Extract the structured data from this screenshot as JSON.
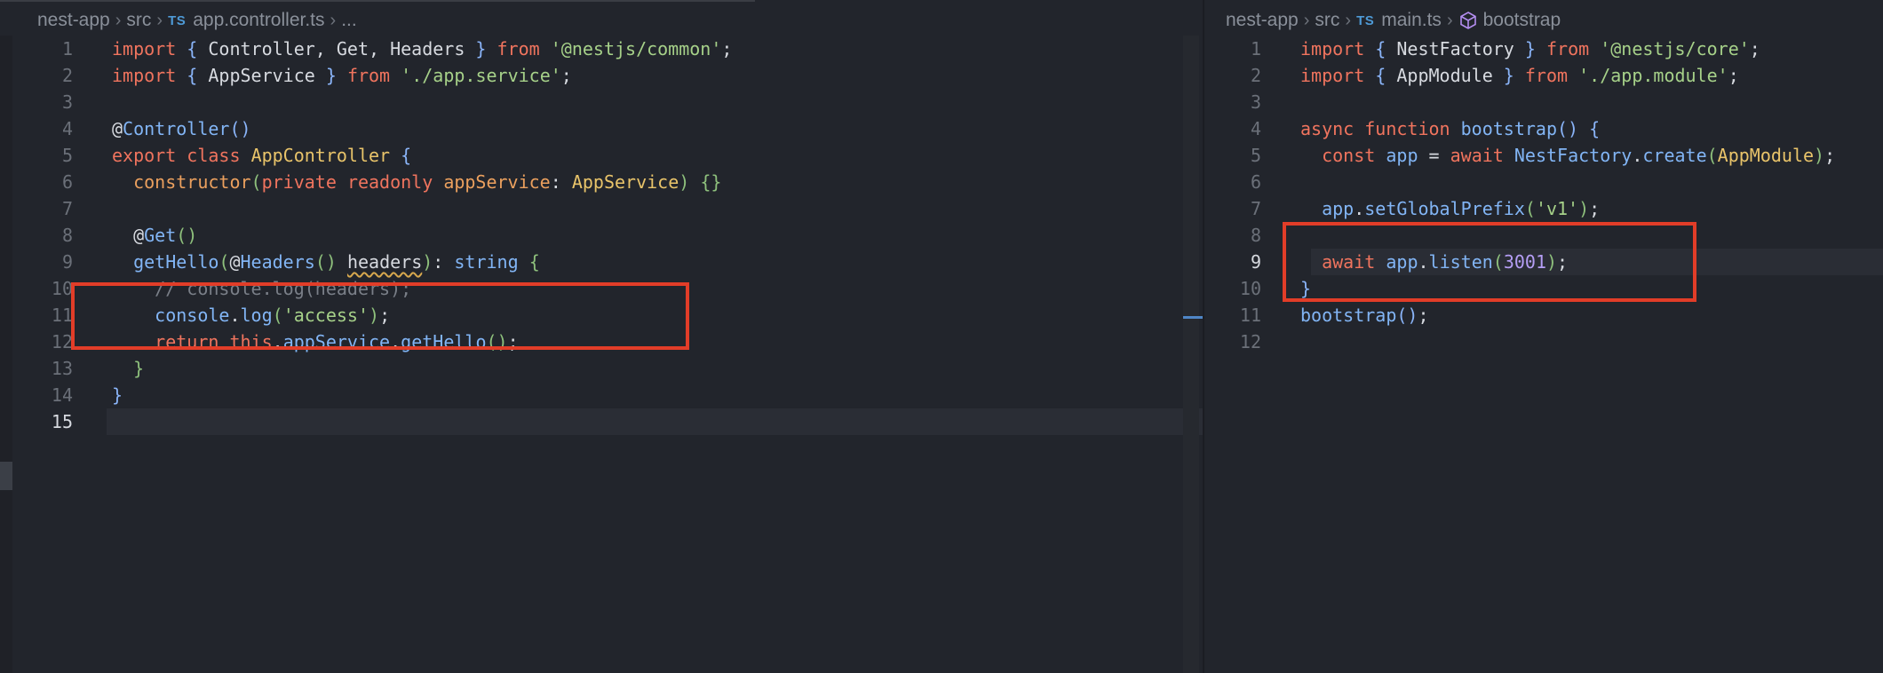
{
  "left_editor": {
    "breadcrumb": {
      "root": "nest-app",
      "folder": "src",
      "file_badge": "TS",
      "file": "app.controller.ts",
      "more": "..."
    },
    "lines": [
      {
        "n": "1",
        "tokens": [
          [
            "k",
            "import"
          ],
          [
            "t",
            " "
          ],
          [
            "pu",
            "{"
          ],
          [
            "t",
            " Controller, Get, Headers "
          ],
          [
            "pu",
            "}"
          ],
          [
            "t",
            " "
          ],
          [
            "k",
            "from"
          ],
          [
            "t",
            " "
          ],
          [
            "s",
            "'@nestjs/common'"
          ],
          [
            "t",
            ";"
          ]
        ]
      },
      {
        "n": "2",
        "tokens": [
          [
            "k",
            "import"
          ],
          [
            "t",
            " "
          ],
          [
            "pu",
            "{"
          ],
          [
            "t",
            " AppService "
          ],
          [
            "pu",
            "}"
          ],
          [
            "t",
            " "
          ],
          [
            "k",
            "from"
          ],
          [
            "t",
            " "
          ],
          [
            "s",
            "'./app.service'"
          ],
          [
            "t",
            ";"
          ]
        ]
      },
      {
        "n": "3",
        "tokens": []
      },
      {
        "n": "4",
        "tokens": [
          [
            "dec",
            "@"
          ],
          [
            "fn",
            "Controller"
          ],
          [
            "pu",
            "()"
          ]
        ]
      },
      {
        "n": "5",
        "tokens": [
          [
            "k",
            "export"
          ],
          [
            "t",
            " "
          ],
          [
            "k",
            "class"
          ],
          [
            "t",
            " "
          ],
          [
            "cls",
            "AppController"
          ],
          [
            "t",
            " "
          ],
          [
            "pu",
            "{"
          ]
        ]
      },
      {
        "n": "6",
        "tokens": [
          [
            "t",
            "  "
          ],
          [
            "var",
            "constructor"
          ],
          [
            "p",
            "("
          ],
          [
            "k",
            "private"
          ],
          [
            "t",
            " "
          ],
          [
            "k",
            "readonly"
          ],
          [
            "t",
            " "
          ],
          [
            "var",
            "appService"
          ],
          [
            "t",
            ": "
          ],
          [
            "cls",
            "AppService"
          ],
          [
            "p",
            ")"
          ],
          [
            "t",
            " "
          ],
          [
            "p",
            "{}"
          ]
        ]
      },
      {
        "n": "7",
        "tokens": []
      },
      {
        "n": "8",
        "tokens": [
          [
            "t",
            "  "
          ],
          [
            "dec",
            "@"
          ],
          [
            "fn",
            "Get"
          ],
          [
            "p",
            "()"
          ]
        ]
      },
      {
        "n": "9",
        "tokens": [
          [
            "t",
            "  "
          ],
          [
            "fn",
            "getHello"
          ],
          [
            "p",
            "("
          ],
          [
            "dec",
            "@"
          ],
          [
            "fn",
            "Headers"
          ],
          [
            "p",
            "()"
          ],
          [
            "t",
            " "
          ],
          [
            "warn",
            "headers"
          ],
          [
            "p",
            ")"
          ],
          [
            "t",
            ": "
          ],
          [
            "fn",
            "string"
          ],
          [
            "t",
            " "
          ],
          [
            "p",
            "{"
          ]
        ]
      },
      {
        "n": "10",
        "tokens": [
          [
            "t",
            "    "
          ],
          [
            "cm",
            "// console.log(headers);"
          ]
        ]
      },
      {
        "n": "11",
        "tokens": [
          [
            "t",
            "    "
          ],
          [
            "fn",
            "console"
          ],
          [
            "t",
            "."
          ],
          [
            "fn",
            "log"
          ],
          [
            "p",
            "("
          ],
          [
            "s",
            "'access'"
          ],
          [
            "p",
            ")"
          ],
          [
            "t",
            ";"
          ]
        ]
      },
      {
        "n": "12",
        "tokens": [
          [
            "t",
            "    "
          ],
          [
            "k",
            "return"
          ],
          [
            "t",
            " "
          ],
          [
            "k",
            "this"
          ],
          [
            "t",
            "."
          ],
          [
            "fn",
            "appService"
          ],
          [
            "t",
            "."
          ],
          [
            "fn",
            "getHello"
          ],
          [
            "p",
            "()"
          ],
          [
            "t",
            ";"
          ]
        ]
      },
      {
        "n": "13",
        "tokens": [
          [
            "t",
            "  "
          ],
          [
            "p",
            "}"
          ]
        ]
      },
      {
        "n": "14",
        "tokens": [
          [
            "pu",
            "}"
          ]
        ]
      },
      {
        "n": "15",
        "tokens": []
      }
    ]
  },
  "right_editor": {
    "breadcrumb": {
      "root": "nest-app",
      "folder": "src",
      "file_badge": "TS",
      "file": "main.ts",
      "symbol": "bootstrap"
    },
    "lines": [
      {
        "n": "1",
        "tokens": [
          [
            "k",
            "import"
          ],
          [
            "t",
            " "
          ],
          [
            "pu",
            "{"
          ],
          [
            "t",
            " NestFactory "
          ],
          [
            "pu",
            "}"
          ],
          [
            "t",
            " "
          ],
          [
            "k",
            "from"
          ],
          [
            "t",
            " "
          ],
          [
            "s",
            "'@nestjs/core'"
          ],
          [
            "t",
            ";"
          ]
        ]
      },
      {
        "n": "2",
        "tokens": [
          [
            "k",
            "import"
          ],
          [
            "t",
            " "
          ],
          [
            "pu",
            "{"
          ],
          [
            "t",
            " AppModule "
          ],
          [
            "pu",
            "}"
          ],
          [
            "t",
            " "
          ],
          [
            "k",
            "from"
          ],
          [
            "t",
            " "
          ],
          [
            "s",
            "'./app.module'"
          ],
          [
            "t",
            ";"
          ]
        ]
      },
      {
        "n": "3",
        "tokens": []
      },
      {
        "n": "4",
        "tokens": [
          [
            "k",
            "async"
          ],
          [
            "t",
            " "
          ],
          [
            "k",
            "function"
          ],
          [
            "t",
            " "
          ],
          [
            "fn",
            "bootstrap"
          ],
          [
            "pu",
            "()"
          ],
          [
            "t",
            " "
          ],
          [
            "pu",
            "{"
          ]
        ]
      },
      {
        "n": "5",
        "tokens": [
          [
            "t",
            "  "
          ],
          [
            "k",
            "const"
          ],
          [
            "t",
            " "
          ],
          [
            "fn",
            "app"
          ],
          [
            "t",
            " = "
          ],
          [
            "k",
            "await"
          ],
          [
            "t",
            " "
          ],
          [
            "fn",
            "NestFactory"
          ],
          [
            "t",
            "."
          ],
          [
            "fn",
            "create"
          ],
          [
            "p",
            "("
          ],
          [
            "cls",
            "AppModule"
          ],
          [
            "p",
            ")"
          ],
          [
            "t",
            ";"
          ]
        ]
      },
      {
        "n": "6",
        "tokens": []
      },
      {
        "n": "7",
        "tokens": [
          [
            "t",
            "  "
          ],
          [
            "fn",
            "app"
          ],
          [
            "t",
            "."
          ],
          [
            "fn",
            "setGlobalPrefix"
          ],
          [
            "p",
            "("
          ],
          [
            "s",
            "'v1'"
          ],
          [
            "p",
            ")"
          ],
          [
            "t",
            ";"
          ]
        ]
      },
      {
        "n": "8",
        "tokens": []
      },
      {
        "n": "9",
        "tokens": [
          [
            "t",
            "  "
          ],
          [
            "k",
            "await"
          ],
          [
            "t",
            " "
          ],
          [
            "fn",
            "app"
          ],
          [
            "t",
            "."
          ],
          [
            "fn",
            "listen"
          ],
          [
            "p",
            "("
          ],
          [
            "n",
            "3001"
          ],
          [
            "p",
            ")"
          ],
          [
            "t",
            ";"
          ]
        ]
      },
      {
        "n": "10",
        "tokens": [
          [
            "pu",
            "}"
          ]
        ]
      },
      {
        "n": "11",
        "tokens": [
          [
            "fn",
            "bootstrap"
          ],
          [
            "pu",
            "()"
          ],
          [
            "t",
            ";"
          ]
        ]
      },
      {
        "n": "12",
        "tokens": []
      }
    ]
  },
  "colors": {
    "highlight_box": "#e23d28",
    "background": "#22252c"
  }
}
